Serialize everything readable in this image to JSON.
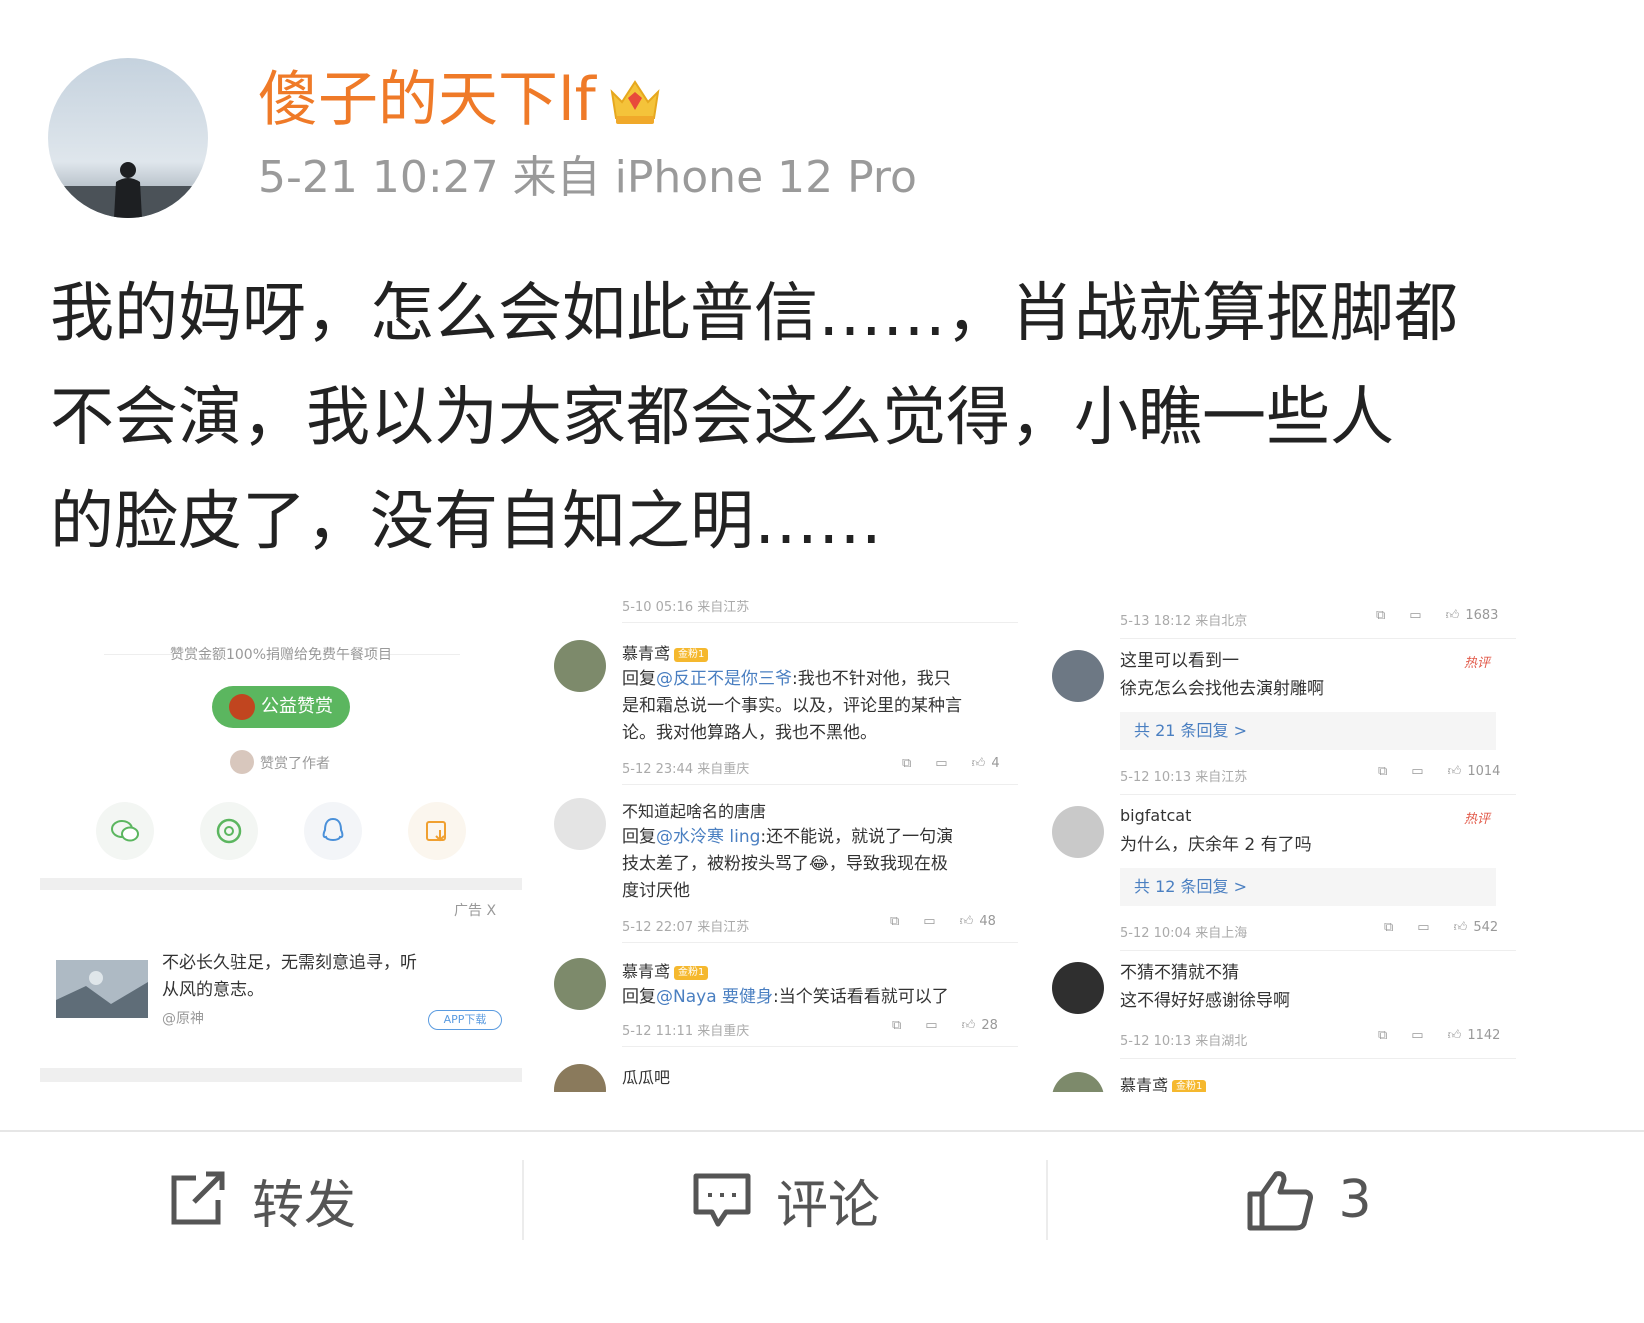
{
  "post": {
    "username": "傻子的天下lf",
    "meta": "5-21 10:27 来自 iPhone 12 Pro",
    "text_lines": [
      "我的妈呀，怎么会如此普信……，肖战就算抠脚都",
      "不会演，我以为大家都会这么觉得，小瞧一些人",
      "的脸皮了，没有自知之明……"
    ]
  },
  "panel1": {
    "reward_text": "赞赏金额100%捐赠给免费午餐项目",
    "reward_button": "公益赞赏",
    "rewarded_text": "赞赏了作者",
    "ad_label": "广告 X",
    "ad_text_1": "不必长久驻足，无需刻意追寻，听",
    "ad_text_2": "从风的意志。",
    "ad_source": "@原神",
    "ad_button": "APP下载"
  },
  "panel2": {
    "top_meta": "5-10 05:16 来自江苏",
    "comments": [
      {
        "name": "慕青鸢",
        "badge": "金粉1",
        "reply_prefix": "回复",
        "mention": "@反正不是你三爷",
        "lines": [
          ":我也不针对他，我只",
          "是和霜总说一个事实。以及，评论里的某种言",
          "论。我对他算路人，我也不黑他。"
        ],
        "meta": "5-12 23:44 来自重庆",
        "likes": "4"
      },
      {
        "name": "不知道起啥名的唐唐",
        "reply_prefix": "回复",
        "mention": "@水泠寒 ling",
        "lines": [
          ":还不能说，就说了一句演",
          "技太差了，被粉按头骂了😂，导致我现在极",
          "度讨厌他"
        ],
        "meta": "5-12 22:07 来自江苏",
        "likes": "48"
      },
      {
        "name": "慕青鸢",
        "badge": "金粉1",
        "reply_prefix": "回复",
        "mention": "@Naya 要健身",
        "lines": [
          ":当个笑话看看就可以了"
        ],
        "meta": "5-12 11:11 来自重庆",
        "likes": "28"
      },
      {
        "name": "瓜瓜吧"
      }
    ]
  },
  "panel3": {
    "top_meta": "5-13 18:12 来自北京",
    "top_likes": "1683",
    "comments": [
      {
        "lines": [
          "这里可以看到一",
          "徐克怎么会找他去演射雕啊"
        ],
        "hot": "热评",
        "replies": "共 21 条回复 >",
        "meta": "5-12 10:13 来自江苏",
        "likes": "1014"
      },
      {
        "name": "bigfatcat",
        "lines": [
          "为什么，庆余年 2 有了吗"
        ],
        "hot": "热评",
        "replies": "共 12 条回复 >",
        "meta": "5-12 10:04 来自上海",
        "likes": "542"
      },
      {
        "lines": [
          "不猜不猜就不猜",
          "这不得好好感谢徐导啊"
        ],
        "meta": "5-12 10:13 来自湖北",
        "likes": "1142"
      },
      {
        "name": "慕青鸢",
        "badge": "金粉1"
      }
    ]
  },
  "toolbar": {
    "repost_label": "转发",
    "comment_label": "评论",
    "like_count": "3"
  },
  "colors": {
    "username": "#ef7a28",
    "reward_green": "#5bb65f",
    "mention_blue": "#4a7fc1",
    "badge_gold": "#f5b82e",
    "hot_red": "#e25a4a"
  },
  "icons": [
    "crown-icon",
    "wechat-icon",
    "moments-icon",
    "qq-icon",
    "save-image-icon",
    "repost-icon",
    "comment-icon",
    "like-icon"
  ]
}
